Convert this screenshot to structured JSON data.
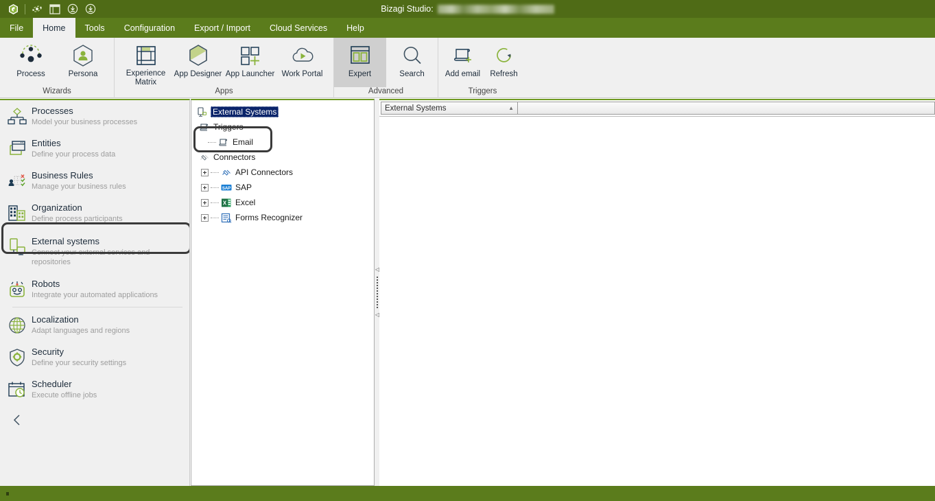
{
  "window": {
    "title_prefix": "Bizagi Studio:",
    "title_redacted": "",
    "accent_green": "#5b7c1c",
    "titlebar_green": "#4f6b16",
    "ribbon_bg": "#f0f0f0",
    "highlight_ring_color": "#3a3a3a",
    "tree_select_bg": "#0a246a"
  },
  "quick_access": [
    {
      "name": "bizagi-logo-icon",
      "glyph": "logo"
    },
    {
      "name": "undo-icon",
      "glyph": "orbit"
    },
    {
      "name": "layout-icon",
      "glyph": "window"
    },
    {
      "name": "save-icon",
      "glyph": "download-circle"
    },
    {
      "name": "publish-icon",
      "glyph": "download-circle"
    }
  ],
  "menu": {
    "items": [
      {
        "label": "File",
        "active": false
      },
      {
        "label": "Home",
        "active": true
      },
      {
        "label": "Tools",
        "active": false
      },
      {
        "label": "Configuration",
        "active": false
      },
      {
        "label": "Export / Import",
        "active": false
      },
      {
        "label": "Cloud Services",
        "active": false
      },
      {
        "label": "Help",
        "active": false
      }
    ]
  },
  "ribbon": {
    "groups": [
      {
        "label": "Wizards",
        "buttons": [
          {
            "label": "Process",
            "icon": "process-icon",
            "selected": false
          },
          {
            "label": "Persona",
            "icon": "persona-icon",
            "selected": false
          }
        ]
      },
      {
        "label": "Apps",
        "buttons": [
          {
            "label": "Experience Matrix",
            "icon": "experience-matrix-icon",
            "selected": false
          },
          {
            "label": "App Designer",
            "icon": "app-designer-icon",
            "selected": false
          },
          {
            "label": "App Launcher",
            "icon": "app-launcher-icon",
            "selected": false
          },
          {
            "label": "Work Portal",
            "icon": "work-portal-icon",
            "selected": false
          }
        ]
      },
      {
        "label": "Advanced",
        "buttons": [
          {
            "label": "Expert",
            "icon": "expert-icon",
            "selected": true
          },
          {
            "label": "Search",
            "icon": "search-icon",
            "selected": false
          }
        ]
      },
      {
        "label": "Triggers",
        "buttons": [
          {
            "label": "Add email",
            "icon": "add-email-icon",
            "selected": false
          },
          {
            "label": "Refresh",
            "icon": "refresh-icon",
            "selected": false
          }
        ]
      }
    ]
  },
  "sidebar": {
    "items": [
      {
        "title": "Processes",
        "subtitle": "Model your business processes",
        "icon": "processes-icon",
        "highlighted": false
      },
      {
        "title": "Entities",
        "subtitle": "Define your process data",
        "icon": "entities-icon",
        "highlighted": false
      },
      {
        "title": "Business  Rules",
        "subtitle": "Manage your business rules",
        "icon": "business-rules-icon",
        "highlighted": false
      },
      {
        "title": "Organization",
        "subtitle": "Define process participants",
        "icon": "organization-icon",
        "highlighted": false
      },
      {
        "title": "External systems",
        "subtitle": "Connect your external services and repositories",
        "icon": "external-systems-icon",
        "highlighted": true
      },
      {
        "title": "Robots",
        "subtitle": "Integrate your automated applications",
        "icon": "robots-icon",
        "highlighted": false
      },
      {
        "title": "Localization",
        "subtitle": "Adapt  languages  and regions",
        "icon": "localization-icon",
        "highlighted": false
      },
      {
        "title": "Security",
        "subtitle": "Define  your  security  settings",
        "icon": "security-icon",
        "highlighted": false
      },
      {
        "title": "Scheduler",
        "subtitle": "Execute offline jobs",
        "icon": "scheduler-icon",
        "highlighted": false
      }
    ],
    "collapse_label": "‹"
  },
  "tree": {
    "nodes": [
      {
        "label": "External Systems",
        "level": 0,
        "icon": "external-systems-node-icon",
        "expander": "none",
        "selected": true
      },
      {
        "label": "Triggers",
        "level": 1,
        "icon": "triggers-node-icon",
        "expander": "none",
        "selected": false
      },
      {
        "label": "Email",
        "level": 2,
        "icon": "email-node-icon",
        "expander": "none",
        "selected": false,
        "highlighted": true
      },
      {
        "label": "Connectors",
        "level": 1,
        "icon": "connectors-node-icon",
        "expander": "none",
        "selected": false
      },
      {
        "label": "API Connectors",
        "level": 2,
        "icon": "api-connectors-node-icon",
        "expander": "plus",
        "selected": false
      },
      {
        "label": "SAP",
        "level": 2,
        "icon": "sap-node-icon",
        "expander": "plus",
        "selected": false
      },
      {
        "label": "Excel",
        "level": 2,
        "icon": "excel-node-icon",
        "expander": "plus",
        "selected": false
      },
      {
        "label": "Forms Recognizer",
        "level": 2,
        "icon": "forms-recognizer-node-icon",
        "expander": "plus",
        "selected": false
      }
    ]
  },
  "splitter": {
    "top_arrow": "◁",
    "bottom_arrow": "◁"
  },
  "document_tabs": {
    "tabs": [
      {
        "label": "External Systems",
        "close_glyph": "▲",
        "active": true
      }
    ]
  },
  "statusbar": {
    "text": ""
  }
}
